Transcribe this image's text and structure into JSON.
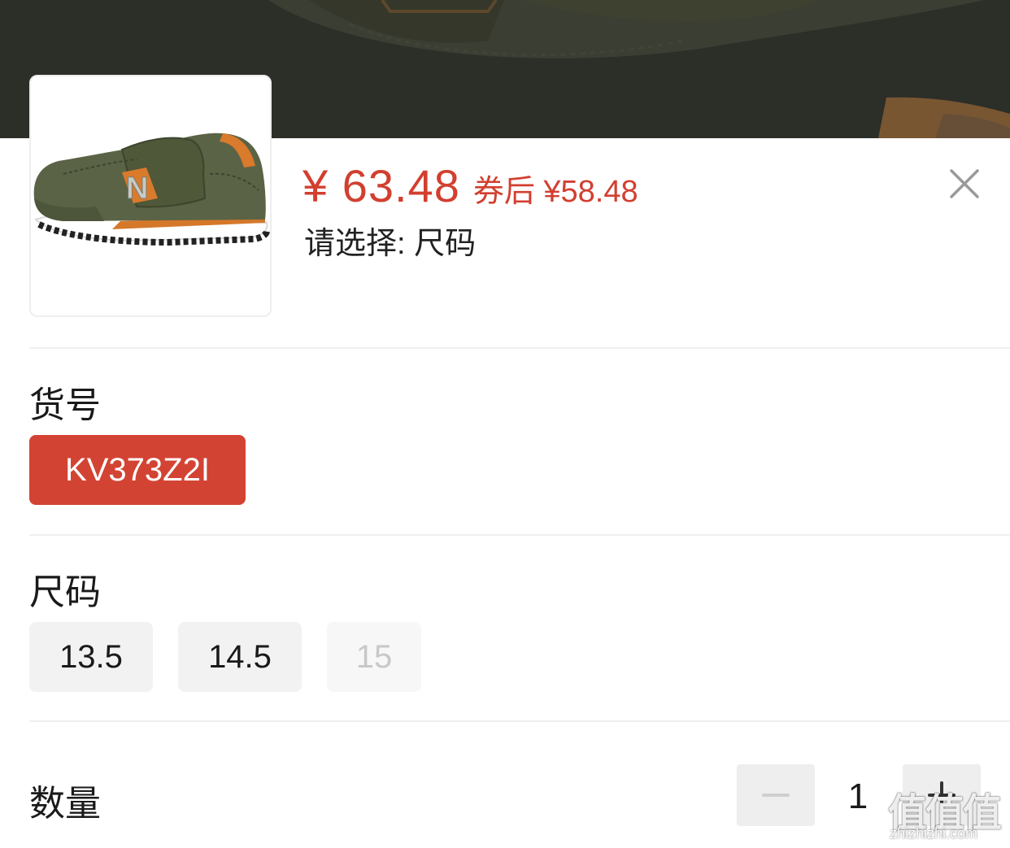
{
  "product": {
    "price": "¥ 63.48",
    "coupon_price": "券后 ¥58.48",
    "select_hint": "请选择: 尺码",
    "image_icon": "sneaker-image"
  },
  "close_icon": "close-icon",
  "sections": {
    "item_no": {
      "label": "货号",
      "options": [
        {
          "label": "KV373Z2I",
          "state": "selected"
        }
      ]
    },
    "size": {
      "label": "尺码",
      "options": [
        {
          "label": "13.5",
          "state": "normal"
        },
        {
          "label": "14.5",
          "state": "normal"
        },
        {
          "label": "15",
          "state": "disabled"
        }
      ]
    },
    "quantity": {
      "label": "数量",
      "value": "1"
    }
  },
  "watermark": {
    "glyphs": "值值值",
    "url": "zhizhizhi.com"
  },
  "colors": {
    "accent": "#d34333",
    "price": "#d23f2f",
    "chip_bg": "#f2f2f2",
    "disabled_text": "#c8c8c8"
  }
}
